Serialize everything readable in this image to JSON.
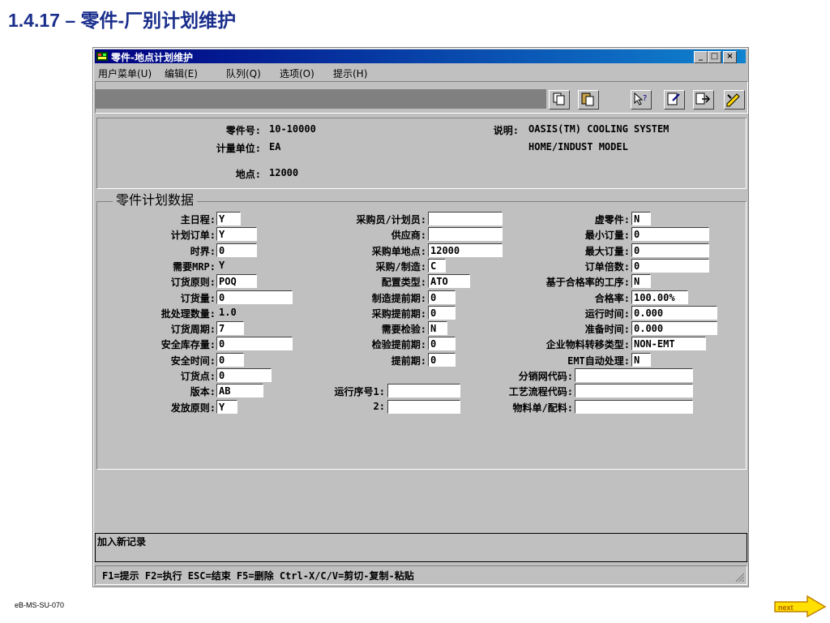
{
  "slide": {
    "title": "1.4.17 – 零件-厂别计划维护",
    "footer_code": "eB-MS-SU-070",
    "next_label": "next"
  },
  "window": {
    "title": "零件-地点计划维护",
    "controls": {
      "minimize": "_",
      "maximize": "□",
      "close": "×"
    }
  },
  "menu": [
    {
      "label": "用户菜单(U)"
    },
    {
      "label": "编辑(E)"
    },
    {
      "label": "队列(Q)"
    },
    {
      "label": "选项(O)"
    },
    {
      "label": "提示(H)"
    }
  ],
  "header": {
    "part_no_label": "零件号:",
    "part_no": "10-10000",
    "uom_label": "计量单位:",
    "uom": "EA",
    "site_label": "地点:",
    "site": "12000",
    "desc_label": "说明:",
    "desc1": "OASIS(TM) COOLING SYSTEM",
    "desc2": "HOME/INDUST MODEL"
  },
  "group_title": "零件计划数据",
  "col1": [
    {
      "label": "主日程:",
      "value": "Y",
      "kind": "field"
    },
    {
      "label": "计划订单:",
      "value": "Y",
      "kind": "field"
    },
    {
      "label": "时界:",
      "value": "0",
      "kind": "field"
    },
    {
      "label": "需要MRP:",
      "value": "Y",
      "kind": "text"
    },
    {
      "label": "订货原则:",
      "value": "POQ",
      "kind": "field"
    },
    {
      "label": "订货量:",
      "value": "0",
      "kind": "field"
    },
    {
      "label": "批处理数量:",
      "value": "1.0",
      "kind": "text"
    },
    {
      "label": "订货周期:",
      "value": "7",
      "kind": "field"
    },
    {
      "label": "安全库存量:",
      "value": "0",
      "kind": "field"
    },
    {
      "label": "安全时间:",
      "value": "0",
      "kind": "field"
    },
    {
      "label": "订货点:",
      "value": "0",
      "kind": "field"
    },
    {
      "label": "版本:",
      "value": "AB",
      "kind": "field"
    },
    {
      "label": "发放原则:",
      "value": "Y",
      "kind": "field"
    }
  ],
  "col2": [
    {
      "label": "采购员/计划员:",
      "value": ""
    },
    {
      "label": "供应商:",
      "value": ""
    },
    {
      "label": "采购单地点:",
      "value": "12000"
    },
    {
      "label": "采购/制造:",
      "value": "C"
    },
    {
      "label": "配置类型:",
      "value": "ATO"
    },
    {
      "label": "制造提前期:",
      "value": "0"
    },
    {
      "label": "采购提前期:",
      "value": "0"
    },
    {
      "label": "需要检验:",
      "value": "N"
    },
    {
      "label": "检验提前期:",
      "value": "0"
    },
    {
      "label": "提前期:",
      "value": "0"
    }
  ],
  "col2b": [
    {
      "label": "运行序号1:",
      "value": ""
    },
    {
      "label": "2:",
      "value": ""
    }
  ],
  "col3": [
    {
      "label": "虚零件:",
      "value": "N"
    },
    {
      "label": "最小订量:",
      "value": "0"
    },
    {
      "label": "最大订量:",
      "value": "0"
    },
    {
      "label": "订单倍数:",
      "value": "0"
    },
    {
      "label": "基于合格率的工序:",
      "value": "N"
    },
    {
      "label": "合格率:",
      "value": "100.00%"
    },
    {
      "label": "运行时间:",
      "value": "0.000"
    },
    {
      "label": "准备时间:",
      "value": "0.000"
    },
    {
      "label": "企业物料转移类型:",
      "value": "NON-EMT"
    },
    {
      "label": "EMT自动处理:",
      "value": "N"
    }
  ],
  "col3b": [
    {
      "label": "分销网代码:",
      "value": ""
    },
    {
      "label": "工艺流程代码:",
      "value": ""
    },
    {
      "label": "物料单/配料:",
      "value": ""
    }
  ],
  "message": "加入新记录",
  "status": "F1=提示 F2=执行 ESC=结束 F5=删除 Ctrl-X/C/V=剪切-复制-粘贴"
}
